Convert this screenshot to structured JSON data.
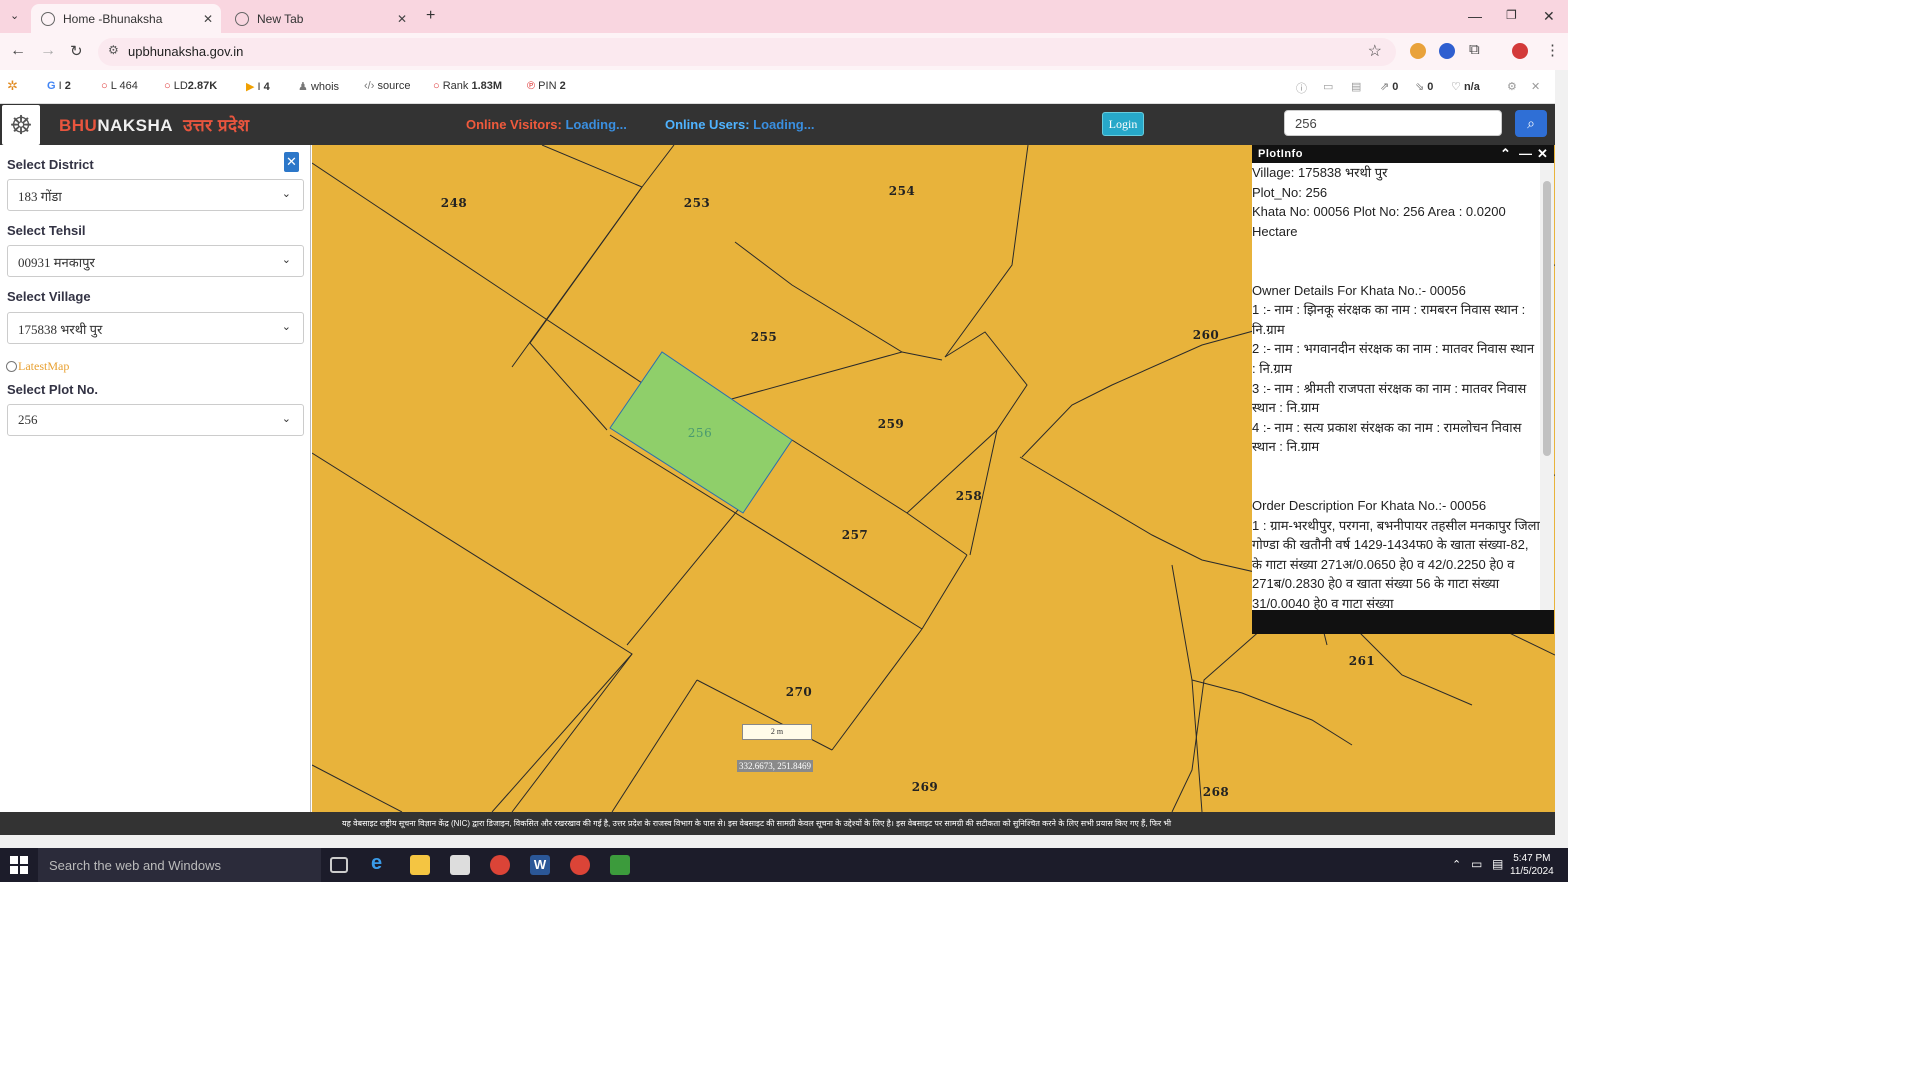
{
  "browser": {
    "tabs": [
      {
        "title": "Home -Bhunaksha",
        "active": true
      },
      {
        "title": "New Tab",
        "active": false
      }
    ],
    "url": "upbhunaksha.gov.in"
  },
  "seo_toolbar": {
    "google": "2",
    "links": "L 464",
    "ld": "LD",
    "ld_value": "2.87K",
    "bing": "4",
    "whois": "whois",
    "source": "source",
    "rank": "Rank",
    "rank_value": "1.83M",
    "pin": "PIN",
    "pin_value": "2",
    "ext_count1": "0",
    "ext_count2": "0",
    "na": "n/a"
  },
  "site": {
    "brand_bhu": "BHU",
    "brand_naksha": "NAKSHA",
    "brand_state": "उत्तर प्रदेश",
    "online_visitors_label": "Online Visitors:",
    "online_visitors_value": "Loading...",
    "online_users_label": "Online Users:",
    "online_users_value": "Loading...",
    "login": "Login",
    "search_value": "256"
  },
  "left_panel": {
    "district_label": "Select District",
    "district_value": "183 गोंडा",
    "tehsil_label": "Select Tehsil",
    "tehsil_value": "00931 मनकापुर",
    "village_label": "Select Village",
    "village_value": "175838 भरथी पुर",
    "latest_map": "LatestMap",
    "plot_label": "Select Plot No.",
    "plot_value": "256"
  },
  "map": {
    "labels": [
      "248",
      "253",
      "254",
      "255",
      "256",
      "259",
      "260",
      "258",
      "257",
      "270",
      "269",
      "268",
      "261"
    ],
    "scale": "2 m",
    "coordinates": "332.6673, 251.8469",
    "colors": {
      "parcel": "#e8b33b",
      "selected": "#8fcf6a",
      "outline": "#2a2a2a"
    }
  },
  "plot_info": {
    "title": "PlotInfo",
    "lines": [
      "Village: 175838 भरथी पुर",
      "Plot_No: 256",
      "Khata No: 00056 Plot No: 256 Area : 0.0200 Hectare",
      "",
      "",
      "Owner Details For Khata No.:- 00056",
      "1 :- नाम : झिनकू संरक्षक का नाम : रामबरन निवास स्थान : नि.ग्राम",
      "2 :- नाम : भगवानदीन संरक्षक का नाम : मातवर निवास स्थान : नि.ग्राम",
      "3 :- नाम : श्रीमती राजपता संरक्षक का नाम : मातवर निवास स्थान : नि.ग्राम",
      "4 :- नाम : सत्य प्रकाश संरक्षक का नाम : रामलोचन निवास स्थान : नि.ग्राम",
      "",
      "",
      "Order Description For Khata No.:- 00056",
      "1 : ग्राम-भरथीपुर, परगना, बभनीपायर तहसील मनकापुर जिला गोण्डा की खतौनी वर्ष 1429-1434फ0 के खाता संख्या-82, के गाटा संख्या 271अ/0.0650 हे0 व 42/0.2250 हे0 व 271ब/0.2830 हे0 व खाता संख्या 56 के गाटा संख्या 31/0.0040 हे0 व गाटा संख्या"
    ]
  },
  "footer": {
    "disclaimer": "यह वेबसाइट राष्ट्रीय सूचना विज्ञान केंद्र (NIC) द्वारा डिजाइन, विकसित और रखरखाव की गई है, उत्तर प्रदेश के राजस्व विभाग के पास से। इस वेबसाइट की सामग्री केवल सूचना के उद्देश्यों के लिए है। इस वेबसाइट पर सामग्री की सटीकता को सुनिश्चित करने के लिए सभी प्रयास किए गए हैं, फिर भी"
  },
  "taskbar": {
    "search_placeholder": "Search the web and Windows",
    "time": "5:47 PM",
    "date": "11/5/2024"
  }
}
